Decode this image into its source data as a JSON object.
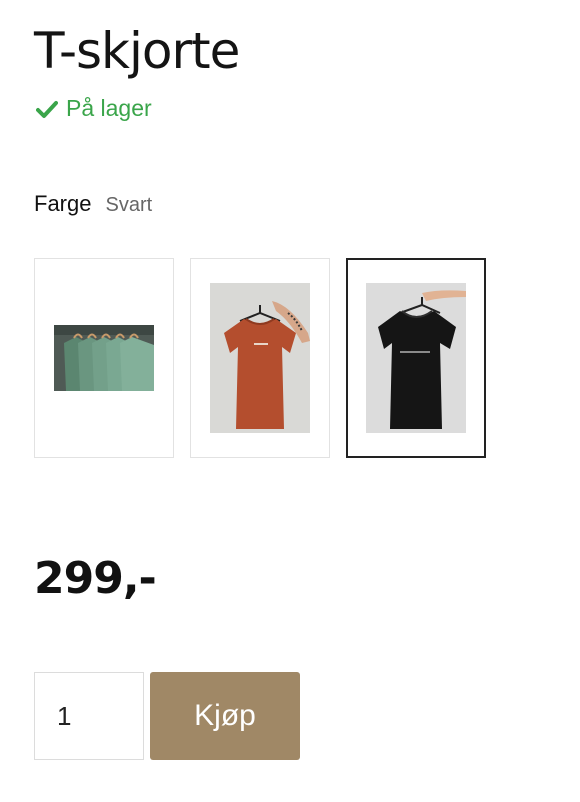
{
  "product": {
    "title": "T-skjorte",
    "stock_status": "På lager",
    "stock_icon": "check-icon",
    "stock_color": "#3aa54a"
  },
  "variant": {
    "label": "Farge",
    "selected_value": "Svart",
    "options": [
      {
        "name": "green-shirts-swatch",
        "color": "#5e8a72"
      },
      {
        "name": "orange-shirt-swatch",
        "color": "#b5502f"
      },
      {
        "name": "black-shirt-swatch",
        "color": "#161616",
        "selected": true
      }
    ]
  },
  "price": {
    "display": "299,-"
  },
  "purchase": {
    "quantity": "1",
    "buy_label": "Kjøp",
    "buy_color": "#a08866"
  }
}
